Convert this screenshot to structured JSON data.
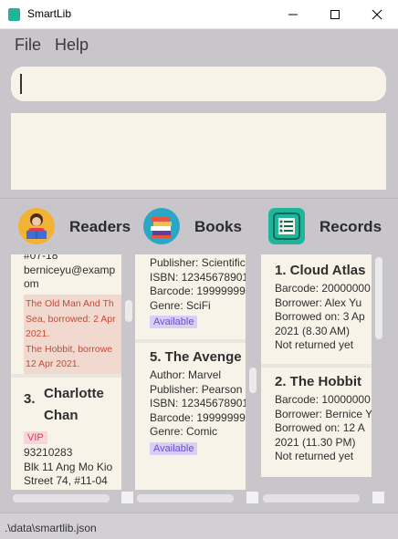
{
  "window": {
    "title": "SmartLib"
  },
  "menu": {
    "file": "File",
    "help": "Help"
  },
  "command": {
    "value": ""
  },
  "columns": {
    "readers": {
      "title": "Readers",
      "icon": "reader-icon"
    },
    "books": {
      "title": "Books",
      "icon": "books-icon"
    },
    "records": {
      "title": "Records",
      "icon": "records-icon"
    }
  },
  "readers": {
    "card_top": {
      "address_tail": "#07-18",
      "email_1": "berniceyu@examp",
      "email_2": "om",
      "borrowed": [
        "The Old Man And Th",
        "Sea, borrowed: 2 Apr",
        "2021.",
        "The Hobbit, borrowe",
        "12 Apr 2021."
      ]
    },
    "card_2": {
      "index": "3.",
      "name_1": "Charlotte",
      "name_2": "Chan",
      "tag": "VIP",
      "phone": "93210283",
      "address_1": "Blk 11 Ang Mo Kio",
      "address_2": "Street 74, #11-04"
    }
  },
  "books": {
    "card_top": {
      "publisher": "Publisher: Scientific",
      "isbn": "ISBN: 12345678901",
      "barcode": "Barcode: 19999999",
      "genre": "Genre: SciFi",
      "tag": "Available"
    },
    "card_2": {
      "title": "5.  The Avenge",
      "author": "Author: Marvel",
      "publisher": "Publisher: Pearson",
      "isbn": "ISBN: 12345678901",
      "barcode": "Barcode: 19999999",
      "genre": "Genre: Comic",
      "tag": "Available"
    }
  },
  "records": {
    "card_1": {
      "title": "1.  Cloud Atlas",
      "barcode": "Barcode: 20000000",
      "borrower": "Borrower: Alex Yu",
      "borrowed_1": "Borrowed on: 3 Ap",
      "borrowed_2": "2021 (8.30 AM)",
      "returned": "Not returned yet"
    },
    "card_2": {
      "title": "2.  The Hobbit",
      "barcode": "Barcode: 10000000",
      "borrower": "Borrower: Bernice Y",
      "borrowed_1": "Borrowed on: 12 A",
      "borrowed_2": "2021 (11.30 PM)",
      "returned": "Not returned yet"
    }
  },
  "status": {
    "path": ".\\data\\smartlib.json"
  },
  "colors": {
    "accent": "#1fb59a",
    "card_bg": "#f7f3e9",
    "window_bg": "#c9c6cb",
    "available": "#6a4bd0",
    "vip": "#d93d58"
  }
}
